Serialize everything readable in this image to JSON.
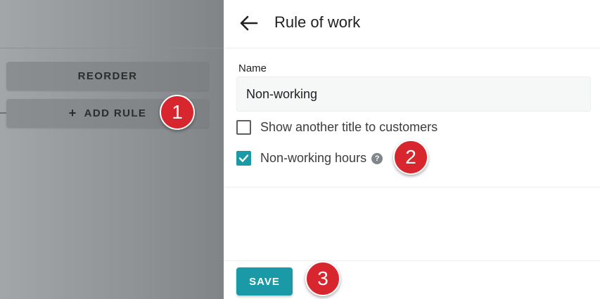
{
  "left": {
    "reorder_label": "REORDER",
    "add_rule_label": "ADD RULE",
    "add_rule_icon": "plus-icon"
  },
  "header": {
    "title": "Rule of work",
    "back_icon": "arrow-left-icon"
  },
  "form": {
    "name_label": "Name",
    "name_value": "Non-working",
    "show_title_label": "Show another title to customers",
    "show_title_checked": false,
    "non_working_label": "Non-working hours",
    "non_working_checked": true,
    "help_icon": "question-circle-icon"
  },
  "footer": {
    "save_label": "SAVE"
  },
  "annotations": [
    "1",
    "2",
    "3"
  ],
  "colors": {
    "accent": "#1a9aa6",
    "badge": "#d8262e"
  }
}
